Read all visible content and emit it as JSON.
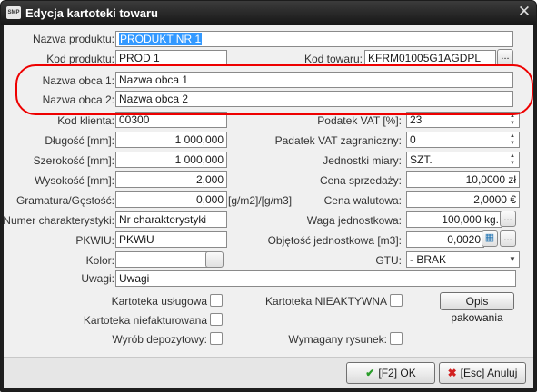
{
  "window": {
    "title": "Edycja kartoteki towaru",
    "app_badge": "SMP"
  },
  "fields": {
    "nazwa_produktu": {
      "label": "Nazwa produktu:",
      "value": "PRODUKT NR 1"
    },
    "kod_produktu": {
      "label": "Kod produktu:",
      "value": "PROD 1"
    },
    "kod_towaru": {
      "label": "Kod towaru:",
      "value": "KFRM01005G1AGDPL"
    },
    "nazwa_obca_1": {
      "label": "Nazwa obca 1:",
      "value": "Nazwa obca 1"
    },
    "nazwa_obca_2": {
      "label": "Nazwa obca 2:",
      "value": "Nazwa obca 2"
    },
    "kod_klienta": {
      "label": "Kod klienta:",
      "value": "00300"
    },
    "dlugosc": {
      "label": "Długość [mm]:",
      "value": "1 000,000"
    },
    "szerokosc": {
      "label": "Szerokość [mm]:",
      "value": "1 000,000"
    },
    "wysokosc": {
      "label": "Wysokość [mm]:",
      "value": "2,000"
    },
    "gramatura": {
      "label": "Gramatura/Gęstość:",
      "value": "0,000",
      "unit": "[g/m2]/[g/m3]"
    },
    "numer_charakterystyki": {
      "label": "Numer charakterystyki:",
      "value": "Nr charakterystyki"
    },
    "pkwiu": {
      "label": "PKWIU:",
      "value": "PKWiU"
    },
    "kolor": {
      "label": "Kolor:"
    },
    "uwagi": {
      "label": "Uwagi:",
      "value": "Uwagi"
    },
    "podatek_vat": {
      "label": "Podatek VAT [%]:",
      "value": "23"
    },
    "podatek_vat_zagr": {
      "label": "Padatek VAT zagraniczny:",
      "value": "0"
    },
    "jednostki_miary": {
      "label": "Jednostki miary:",
      "value": "SZT."
    },
    "cena_sprzedazy": {
      "label": "Cena sprzedaży:",
      "value": "10,0000 zł"
    },
    "cena_walutowa": {
      "label": "Cena walutowa:",
      "value": "2,0000 €"
    },
    "waga_jednostkowa": {
      "label": "Waga jednostkowa:",
      "value": "100,000 kg."
    },
    "objetosc_jednostkowa": {
      "label": "Objętość jednostkowa [m3]:",
      "value": "0,0020"
    },
    "gtu": {
      "label": "GTU:",
      "value": "- BRAK"
    }
  },
  "checkboxes": {
    "kartoteka_uslugowa": "Kartoteka usługowa",
    "kartoteka_niefakturowana": "Kartoteka niefakturowana",
    "wyrob_depozytowy": "Wyrób depozytowy:",
    "kartoteka_nieaktywna": "Kartoteka NIEAKTYWNA",
    "wymagany_rysunek": "Wymagany rysunek:"
  },
  "buttons": {
    "dots": "...",
    "opis_pakowania": "Opis pakowania",
    "ok": "[F2] OK",
    "ok_icon": "✔",
    "cancel": "[Esc] Anuluj",
    "cancel_icon": "✖",
    "close": "✕"
  },
  "icons": {
    "spin": "▲\n▼",
    "dropdown": "▼",
    "calculator": "▦"
  },
  "colors": {
    "highlight": "#3399ff",
    "annotation": "#e00000",
    "ok_check": "#2a9d2a",
    "cancel_x": "#d22020"
  }
}
